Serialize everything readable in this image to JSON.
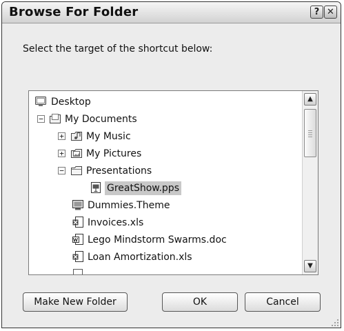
{
  "window": {
    "title": "Browse For Folder",
    "help_label": "?",
    "close_label": "✕"
  },
  "prompt": "Select the target of the shortcut below:",
  "tree": {
    "items": [
      {
        "label": "Desktop",
        "icon": "desktop-icon"
      },
      {
        "label": "My Documents",
        "icon": "documents-folder-icon",
        "expander": "−"
      },
      {
        "label": "My Music",
        "icon": "music-folder-icon",
        "expander": "+"
      },
      {
        "label": "My Pictures",
        "icon": "pictures-folder-icon",
        "expander": "+"
      },
      {
        "label": "Presentations",
        "icon": "folder-icon",
        "expander": "−"
      },
      {
        "label": "GreatShow.pps",
        "icon": "slideshow-file-icon",
        "selected": true
      },
      {
        "label": "Dummies.Theme",
        "icon": "theme-file-icon"
      },
      {
        "label": "Invoices.xls",
        "icon": "excel-file-icon"
      },
      {
        "label": "Lego Mindstorm Swarms.doc",
        "icon": "word-file-icon"
      },
      {
        "label": "Loan Amortization.xls",
        "icon": "excel-file-icon"
      }
    ],
    "scroll_up": "▲",
    "scroll_down": "▼"
  },
  "buttons": {
    "make_new_folder": "Make New Folder",
    "ok": "OK",
    "cancel": "Cancel"
  },
  "colors": {
    "selection": "#c8c8c8",
    "dialog_bg": "#ececec"
  }
}
